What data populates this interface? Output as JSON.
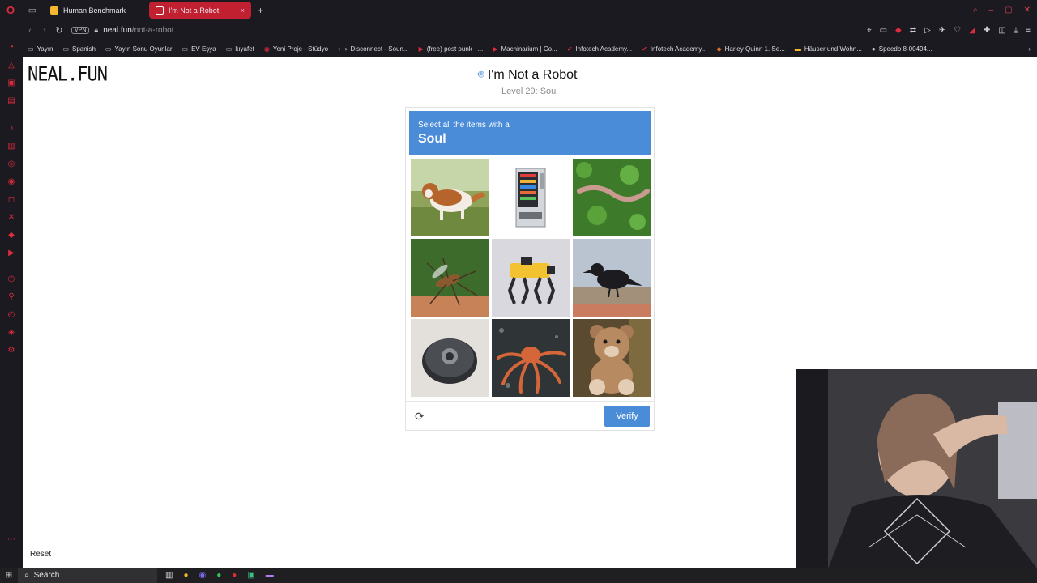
{
  "browser": {
    "tabs": [
      {
        "label": "Human Benchmark",
        "active": false,
        "color": "#f5b82e"
      },
      {
        "label": "I'm Not a Robot",
        "active": true,
        "color": "#c12031"
      }
    ],
    "new_tab_icon": "+",
    "address": {
      "vpn_label": "VPN",
      "host": "neal.fun",
      "path": "/not-a-robot"
    },
    "bookmarks": [
      {
        "label": "Yayın",
        "icon": "folder-icon"
      },
      {
        "label": "Spanish",
        "icon": "folder-icon"
      },
      {
        "label": "Yayın Sonu Oyunlar",
        "icon": "folder-icon"
      },
      {
        "label": "EV Eşya",
        "icon": "folder-icon"
      },
      {
        "label": "kıyafet",
        "icon": "folder-icon"
      },
      {
        "label": "Yeni Proje - Stüdyo",
        "icon": "site-icon"
      },
      {
        "label": "Disconnect - Soun...",
        "icon": "link-icon"
      },
      {
        "label": "(free) post punk +...",
        "icon": "youtube-icon"
      },
      {
        "label": "Machinarium | Co...",
        "icon": "youtube-icon"
      },
      {
        "label": "Infotech Academy...",
        "icon": "site-icon"
      },
      {
        "label": "Infotech Academy...",
        "icon": "site-icon"
      },
      {
        "label": "Harley Quinn 1. Se...",
        "icon": "site-icon"
      },
      {
        "label": "Häuser und Wohn...",
        "icon": "site-icon"
      },
      {
        "label": "Speedo 8-00494...",
        "icon": "site-icon"
      }
    ]
  },
  "page": {
    "logo": "NEAL.FUN",
    "title": "I'm Not a Robot",
    "level": "Level 29: Soul",
    "captcha": {
      "instruction": "Select all the items with a",
      "keyword": "Soul",
      "tiles": [
        {
          "name": "dog"
        },
        {
          "name": "vending-machine"
        },
        {
          "name": "earthworm"
        },
        {
          "name": "mosquito"
        },
        {
          "name": "robot-dog"
        },
        {
          "name": "crow"
        },
        {
          "name": "robot-vacuum"
        },
        {
          "name": "octopus"
        },
        {
          "name": "teddy-bear"
        }
      ],
      "verify_label": "Verify"
    },
    "reset_label": "Reset"
  },
  "taskbar": {
    "search_label": "Search"
  },
  "colors": {
    "accent": "#4b8cd8",
    "browser_red": "#c12031"
  }
}
